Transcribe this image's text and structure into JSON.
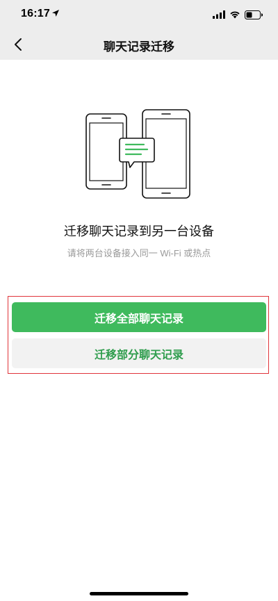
{
  "status_bar": {
    "time": "16:17",
    "location_icon": "location-arrow-icon",
    "signal_icon": "cellular-signal-icon",
    "wifi_icon": "wifi-icon",
    "battery_icon": "battery-icon"
  },
  "nav": {
    "title": "聊天记录迁移",
    "back_icon": "chevron-left-icon"
  },
  "content": {
    "illustration_icon": "phone-to-tablet-transfer-icon",
    "headline": "迁移聊天记录到另一台设备",
    "subline": "请将两台设备接入同一 Wi-Fi 或热点"
  },
  "buttons": {
    "migrate_all": "迁移全部聊天记录",
    "migrate_partial": "迁移部分聊天记录"
  },
  "colors": {
    "accent_green": "#3fba5d",
    "secondary_text_green": "#2f9d4d",
    "highlight_red": "#e0343a",
    "nav_background": "#ededed"
  }
}
